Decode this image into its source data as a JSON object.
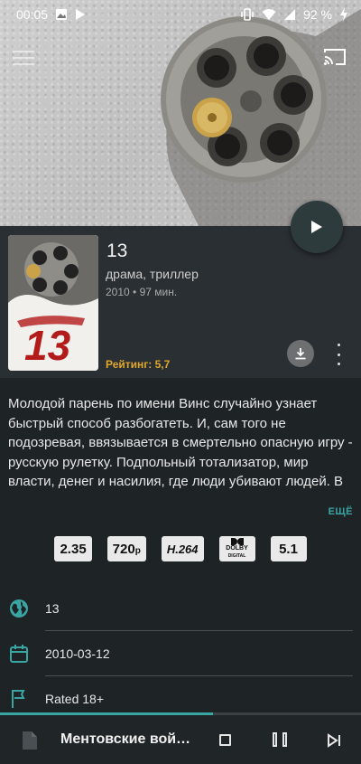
{
  "status_bar": {
    "time": "00:05",
    "battery": "92 %"
  },
  "movie": {
    "title": "13",
    "genres": "драма, триллер",
    "meta": "2010 • 97 мин.",
    "rating": "Рейтинг: 5,7",
    "poster_text": "13",
    "description": "Молодой парень по имени Винс случайно узнает быстрый способ разбогатеть. И, сам того не подозревая, ввязывается в смертельно опасную игру - русскую рулетку. Подпольный тотализатор, мир власти, денег и насилия, где люди убивают людей. В",
    "more_label": "ЕЩЁ"
  },
  "badges": {
    "aspect": "2.35",
    "resolution": "720",
    "resolution_suffix": "p",
    "codec": "H.264",
    "dolby_top": "DOLBY",
    "dolby_bottom": "DIGITAL",
    "channels": "5.1"
  },
  "details": [
    {
      "icon": "globe-icon",
      "text": "13"
    },
    {
      "icon": "calendar-icon",
      "text": "2010-03-12"
    },
    {
      "icon": "flag-icon",
      "text": "Rated 18+"
    }
  ],
  "player": {
    "title": "Ментовские войны",
    "progress": 0.59
  },
  "colors": {
    "accent": "#3aa6a4",
    "rating": "#e0a72b",
    "background": "#1e2326",
    "panel": "#2a2f33"
  }
}
